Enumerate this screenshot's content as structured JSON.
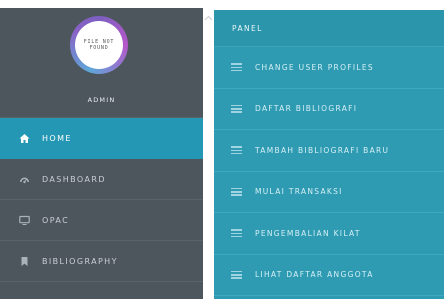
{
  "sidebar": {
    "avatar_text": [
      "FILE NOT",
      "FOUND"
    ],
    "username": "ADMIN",
    "items": [
      {
        "label": "HOME",
        "icon": "home-icon",
        "active": true
      },
      {
        "label": "DASHBOARD",
        "icon": "dashboard-icon",
        "active": false
      },
      {
        "label": "OPAC",
        "icon": "monitor-icon",
        "active": false
      },
      {
        "label": "BIBLIOGRAPHY",
        "icon": "bookmark-icon",
        "active": false
      }
    ]
  },
  "panel": {
    "title": "PANEL",
    "items": [
      {
        "label": "CHANGE USER PROFILES"
      },
      {
        "label": "DAFTAR BIBLIOGRAFI"
      },
      {
        "label": "TAMBAH BIBLIOGRAFI BARU"
      },
      {
        "label": "MULAI TRANSAKSI"
      },
      {
        "label": "PENGEMBALIAN KILAT"
      },
      {
        "label": "LIHAT DAFTAR ANGGOTA"
      }
    ]
  },
  "colors": {
    "sidebar_bg": "#4d565c",
    "active_item": "#2397b3",
    "panel_bg": "#2e9bb2"
  }
}
